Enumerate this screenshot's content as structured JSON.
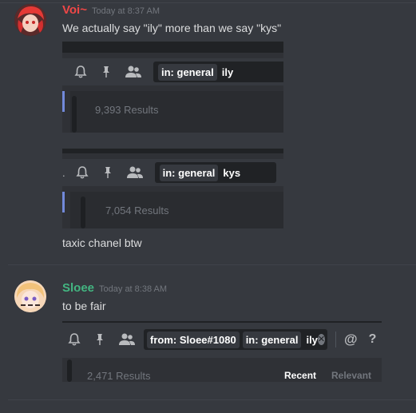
{
  "messages": [
    {
      "username": "Voi~",
      "timestamp": "Today at 8:37 AM",
      "name_color": "#f04747",
      "text": "We actually say \"ily\" more than we say \"kys\"",
      "screens": [
        {
          "filter_label": "in:",
          "filter_value": "general",
          "query": "ily",
          "results": "9,393 Results"
        },
        {
          "filter_label": "in:",
          "filter_value": "general",
          "query": "kys",
          "results": "7,054 Results"
        }
      ],
      "followup": "taxic chanel btw"
    },
    {
      "username": "Sloee",
      "timestamp": "Today at 8:38 AM",
      "name_color": "#43b581",
      "text": "to be fair",
      "screen": {
        "from_label": "from:",
        "from_value": "Sloee#1080",
        "filter_label": "in:",
        "filter_value": "general",
        "query": "ily",
        "results": "2,471 Results",
        "sort_recent": "Recent",
        "sort_relevant": "Relevant",
        "at_symbol": "@",
        "help_symbol": "?"
      }
    }
  ],
  "icons": [
    "bell-icon",
    "pin-icon",
    "members-icon",
    "clear-icon",
    "mention-icon",
    "help-icon"
  ]
}
